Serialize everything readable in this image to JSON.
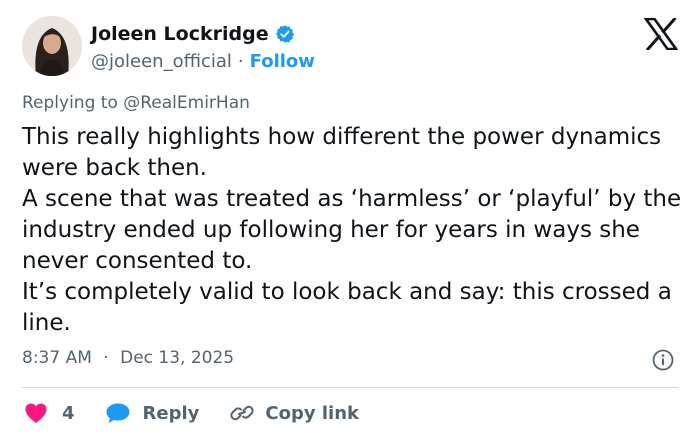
{
  "author": {
    "name": "Joleen Lockridge",
    "handle": "@joleen_official",
    "separator": "·",
    "follow_label": "Follow"
  },
  "reply": {
    "prefix": "Replying to",
    "mention": "@RealEmirHan"
  },
  "tweet": {
    "lines": [
      "This really highlights how different the power dynamics were back then.",
      "A scene that was treated as ‘harmless’ or ‘playful’ by the industry ended up following her for years in ways she never consented to.",
      "It’s completely valid to look back and say: this crossed a line."
    ],
    "time": "8:37 AM",
    "separator": "·",
    "date": "Dec 13, 2025"
  },
  "actions": {
    "like_count": "4",
    "reply_label": "Reply",
    "copy_label": "Copy link"
  },
  "colors": {
    "accent": "#1d9bf0",
    "like": "#f91880",
    "text": "#0f1419",
    "muted": "#536471",
    "divider": "#cfd9de"
  },
  "icons": [
    "verified-badge-icon",
    "x-logo-icon",
    "info-icon",
    "heart-icon",
    "reply-bubble-icon",
    "link-icon"
  ]
}
